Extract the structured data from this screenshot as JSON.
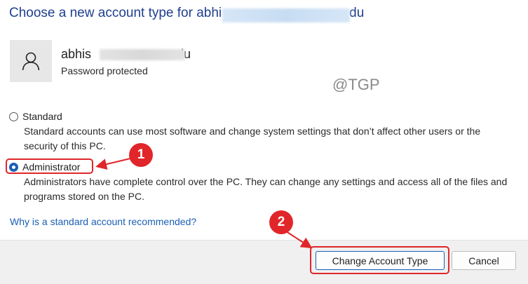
{
  "dialog": {
    "title": "Choose a new account type for abhi",
    "title_tail": "du"
  },
  "account": {
    "avatar_icon": "person-icon",
    "name": "abhis",
    "name_tail": "du",
    "status": "Password protected"
  },
  "watermark": "@TGP",
  "options": {
    "standard": {
      "label": "Standard",
      "description": "Standard accounts can use most software and change system settings that don’t affect other users or the security of this PC.",
      "selected": false
    },
    "administrator": {
      "label": "Administrator",
      "description": "Administrators have complete control over the PC. They can change any settings and access all of the files and programs stored on the PC.",
      "selected": true
    }
  },
  "link_text": "Why is a standard account recommended?",
  "buttons": {
    "change_label": "Change Account Type",
    "cancel_label": "Cancel"
  },
  "annotations": {
    "step1": "1",
    "step2": "2",
    "color": "#e0262a"
  },
  "colors": {
    "accent": "#1a5fb4",
    "title": "#1f3f8f",
    "footer_bg": "#f0f0f0"
  }
}
